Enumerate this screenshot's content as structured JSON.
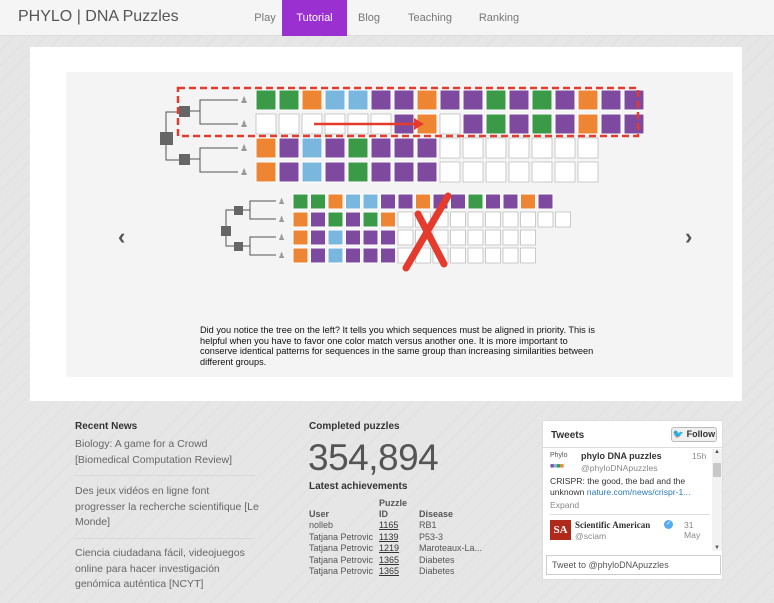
{
  "nav": {
    "brand": "PHYLO | DNA Puzzles",
    "items": [
      {
        "label": "Play",
        "active": false
      },
      {
        "label": "Tutorial",
        "active": true
      },
      {
        "label": "Blog",
        "active": false
      },
      {
        "label": "Teaching",
        "active": false
      },
      {
        "label": "Ranking",
        "active": false
      }
    ],
    "accent": "#9b30d0"
  },
  "carousel": {
    "prev_icon": "chevron-left-icon",
    "next_icon": "chevron-right-icon",
    "caption": "Did you notice the tree on the left? It tells you which sequences must be aligned in priority. This is helpful when you have to favor one color match versus another one. It is more important to conserve identical patterns for sequences in the same group than increasing similarities between different groups.",
    "colors": {
      "green": "#3a9a48",
      "orange": "#ee8533",
      "blue": "#79b7de",
      "purple": "#7d4a9f",
      "red": "#e53b2c"
    },
    "top_puzzle": [
      "GGOBBPPOPPGPGPOPP",
      "......PORPGPGPOPP",
      "OPBPGPPP.......",
      "OPBPGPPP......."
    ],
    "bottom_puzzle": [
      "GGOBBPPOPPGPPOP",
      "OPGPGO..........",
      "OPBPPP........",
      "OPBPPP........"
    ]
  },
  "news": {
    "heading": "Recent News",
    "items": [
      "Biology: A game for a Crowd [Biomedical Computation Review]",
      "Des jeux vidéos en ligne font progresser la recherche scientifique [Le Monde]",
      "Ciencia ciudadana fácil, videojuegos online para hacer investigación genómica auténtica [NCYT]"
    ]
  },
  "completed": {
    "heading": "Completed puzzles",
    "count": "354,894",
    "achievements_heading": "Latest achievements",
    "columns": [
      "User",
      "Puzzle ID",
      "Disease"
    ],
    "rows": [
      {
        "user": "nolleb",
        "id": "1165",
        "disease": "RB1"
      },
      {
        "user": "Tatjana Petrovic",
        "id": "1139",
        "disease": "P53-3"
      },
      {
        "user": "Tatjana Petrovic",
        "id": "1219",
        "disease": "Maroteaux-La..."
      },
      {
        "user": "Tatjana Petrovic",
        "id": "1365",
        "disease": "Diabetes"
      },
      {
        "user": "Tatjana Petrovic",
        "id": "1365",
        "disease": "Diabetes"
      }
    ]
  },
  "tweets": {
    "heading": "Tweets",
    "follow": "Follow",
    "tweet1": {
      "logo": "Phylo",
      "name": "phylo DNA puzzles",
      "handle": "@phyloDNApuzzles",
      "time": "15h",
      "text": "CRISPR: the good, the bad and the unknown",
      "link": "nature.com/news/crispr-1...",
      "expand": "Expand"
    },
    "tweet2": {
      "avatar": "SA",
      "name": "Scientific American",
      "handle": "@sciam",
      "time": "31 May"
    },
    "input_placeholder": "Tweet to @phyloDNApuzzles"
  }
}
